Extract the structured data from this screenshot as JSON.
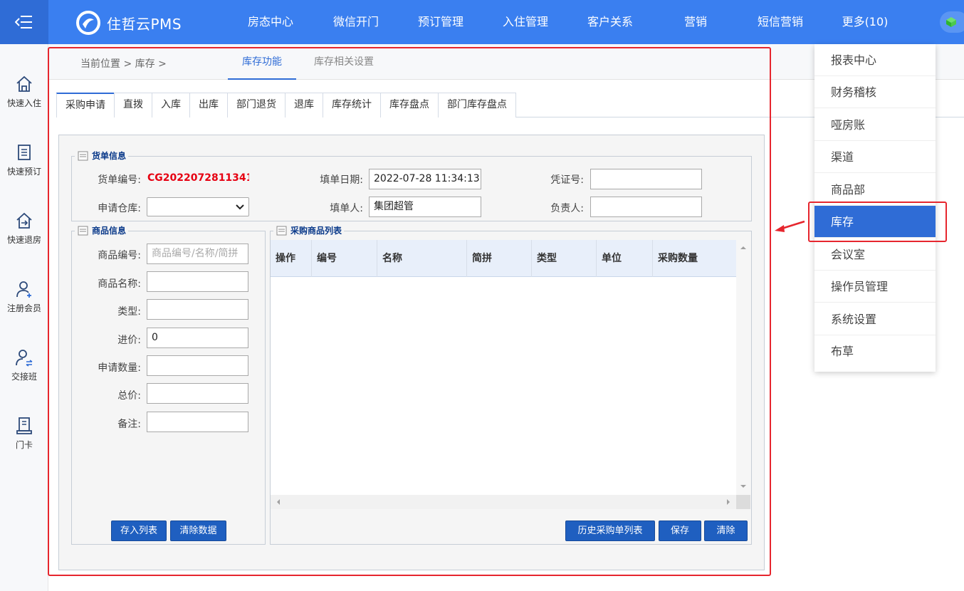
{
  "topbar": {
    "logo_text": "住哲云PMS",
    "nav": [
      "房态中心",
      "微信开门",
      "预订管理",
      "入住管理",
      "客户关系",
      "营销",
      "短信营销",
      "更多(10)"
    ]
  },
  "sidebar": {
    "items": [
      "快速入住",
      "快速预订",
      "快速退房",
      "注册会员",
      "交接班",
      "门卡"
    ]
  },
  "breadcrumb": {
    "text": "当前位置 > 库存 >"
  },
  "func_tabs": [
    "库存功能",
    "库存相关设置"
  ],
  "sub_tabs": [
    "采购申请",
    "直拨",
    "入库",
    "出库",
    "部门退货",
    "退库",
    "库存统计",
    "库存盘点",
    "部门库存盘点"
  ],
  "order_info": {
    "legend": "货单信息",
    "order_no_label": "货单编号:",
    "order_no_value": "CG2022072811341",
    "fill_date_label": "填单日期:",
    "fill_date_value": "2022-07-28 11:34:13",
    "voucher_label": "凭证号:",
    "warehouse_label": "申请仓库:",
    "filler_label": "填单人:",
    "filler_value": "集团超管",
    "owner_label": "负责人:"
  },
  "product_info": {
    "legend": "商品信息",
    "code_label": "商品编号:",
    "code_placeholder": "商品编号/名称/简拼",
    "name_label": "商品名称:",
    "type_label": "类型:",
    "price_label": "进价:",
    "price_value": "0",
    "qty_label": "申请数量:",
    "total_label": "总价:",
    "remark_label": "备注:",
    "save_list_btn": "存入列表",
    "clear_btn": "清除数据"
  },
  "purchase_list": {
    "legend": "采购商品列表",
    "columns": [
      "操作",
      "编号",
      "名称",
      "简拼",
      "类型",
      "单位",
      "采购数量"
    ],
    "history_btn": "历史采购单列表",
    "save_btn": "保存",
    "clear_btn": "清除"
  },
  "more_menu": {
    "items": [
      "报表中心",
      "财务稽核",
      "哑房账",
      "渠道",
      "商品部",
      "库存",
      "会议室",
      "操作员管理",
      "系统设置",
      "布草"
    ],
    "active": "库存"
  },
  "colors": {
    "primary": "#3a7ff0",
    "accent": "#2f6cd6",
    "highlight": "#e6262e",
    "order_no": "#e60012"
  }
}
